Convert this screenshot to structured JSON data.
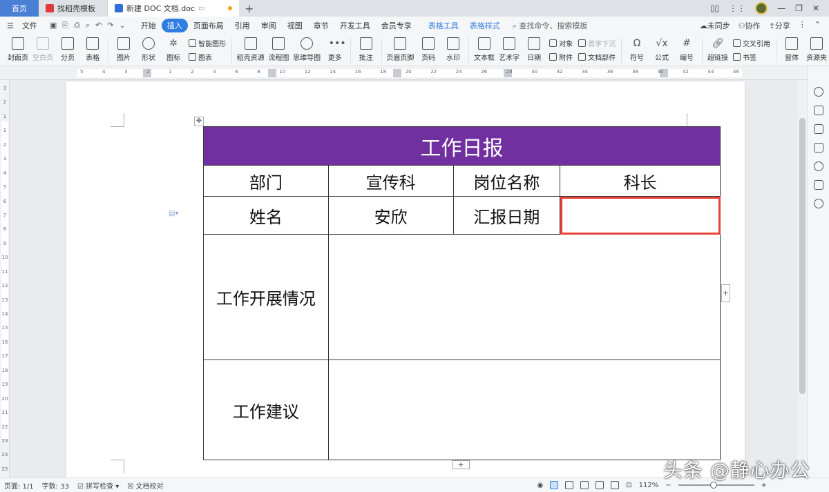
{
  "tabs": {
    "home": "首页",
    "template": "找稻壳模板",
    "document": "新建 DOC 文档.doc",
    "add": "+"
  },
  "menu": {
    "file": "文件",
    "items": [
      "开始",
      "插入",
      "页面布局",
      "引用",
      "审阅",
      "视图",
      "章节",
      "开发工具",
      "会员专享"
    ],
    "active": "插入",
    "context_tools": [
      "表格工具",
      "表格样式"
    ],
    "search": "查找命令、搜索模板",
    "sync": "未同步",
    "collab": "协作",
    "share": "分享"
  },
  "ribbon": {
    "cover_page": "封面页",
    "blank_page": "空白页",
    "page_break": "分页",
    "table": "表格",
    "picture": "图片",
    "shape": "形状",
    "icon": "图标",
    "smart_graphic": "智能图形",
    "chart": "图表",
    "docer_resources": "稻壳资源",
    "flowchart": "流程图",
    "mind_map": "思维导图",
    "more": "更多",
    "comment": "批注",
    "header_footer": "页眉页脚",
    "page_number": "页码",
    "watermark": "水印",
    "textbox": "文本框",
    "word_art": "艺术字",
    "date": "日期",
    "object": "对象",
    "attachment": "附件",
    "drop_cap": "首字下沉",
    "doc_parts": "文档部件",
    "symbol": "符号",
    "formula": "公式",
    "numbering": "编号",
    "hyperlink": "超链接",
    "cross_ref": "交叉引用",
    "bookmark": "书签",
    "form": "窗体",
    "resource_folder": "资源夹"
  },
  "ruler_ticks_h": [
    "5",
    "4",
    "3",
    "2",
    "1",
    "2",
    "4",
    "6",
    "8",
    "10",
    "12",
    "14",
    "16",
    "18",
    "20",
    "22",
    "24",
    "26",
    "28",
    "30",
    "32",
    "34",
    "36",
    "38",
    "40",
    "42",
    "44",
    "46"
  ],
  "ruler_ticks_v": [
    "3",
    "2",
    "1",
    "1",
    "2",
    "3",
    "4",
    "5",
    "6",
    "7",
    "8",
    "9",
    "10",
    "11",
    "12",
    "13",
    "14",
    "15",
    "16",
    "17",
    "18",
    "19",
    "20",
    "21",
    "22",
    "23",
    "24",
    "25"
  ],
  "report": {
    "title": "工作日报",
    "row1": [
      "部门",
      "宣传科",
      "岗位名称",
      "科长"
    ],
    "row2": [
      "姓名",
      "安欣",
      "汇报日期",
      ""
    ],
    "progress_label": "工作开展情况",
    "progress_value": "",
    "suggestion_label": "工作建议",
    "suggestion_value": "",
    "title_color": "#7030a0",
    "selection_color": "#e8413c"
  },
  "status": {
    "page": "页面: 1/1",
    "words": "字数: 33",
    "spellcheck": "拼写检查",
    "proofread": "文档校对",
    "zoom": "112%",
    "zoom_fraction": 0.47
  },
  "watermark_text": "头条 @静心办公"
}
